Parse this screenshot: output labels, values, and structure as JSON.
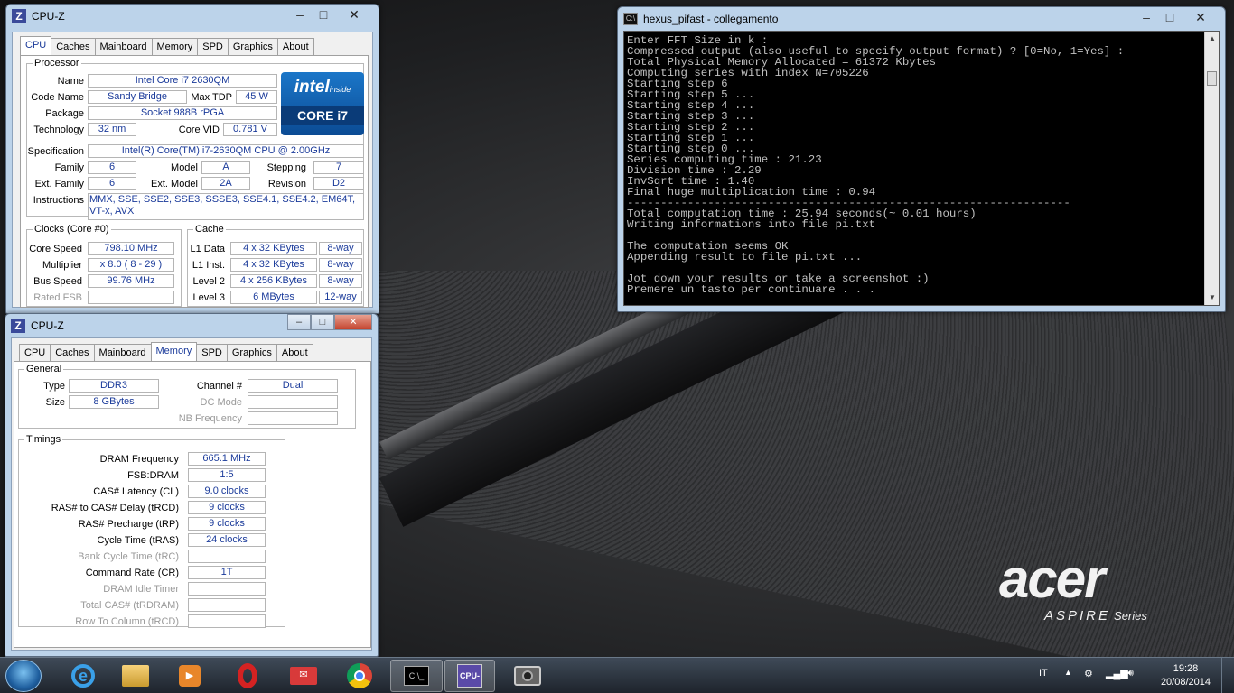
{
  "desktop": {
    "brand": "acer",
    "series_word": "ASPIRE",
    "series_suffix": "Series"
  },
  "cpuz_cpu": {
    "title": "CPU-Z",
    "tabs": [
      "CPU",
      "Caches",
      "Mainboard",
      "Memory",
      "SPD",
      "Graphics",
      "About"
    ],
    "processor": {
      "legend": "Processor",
      "name_label": "Name",
      "name": "Intel Core i7 2630QM",
      "codename_label": "Code Name",
      "codename": "Sandy Bridge",
      "maxtdp_label": "Max TDP",
      "maxtdp": "45 W",
      "package_label": "Package",
      "package": "Socket 988B rPGA",
      "tech_label": "Technology",
      "tech": "32 nm",
      "corevid_label": "Core VID",
      "corevid": "0.781 V",
      "spec_label": "Specification",
      "spec": "Intel(R) Core(TM) i7-2630QM CPU @ 2.00GHz",
      "family_label": "Family",
      "family": "6",
      "model_label": "Model",
      "model": "A",
      "stepping_label": "Stepping",
      "stepping": "7",
      "extfamily_label": "Ext. Family",
      "extfamily": "6",
      "extmodel_label": "Ext. Model",
      "extmodel": "2A",
      "revision_label": "Revision",
      "revision": "D2",
      "instr_label": "Instructions",
      "instr": "MMX, SSE, SSE2, SSE3, SSSE3, SSE4.1, SSE4.2, EM64T, VT-x, AVX"
    },
    "logo": {
      "intel": "intel",
      "inside": "inside",
      "core": "CORE i7"
    },
    "clocks": {
      "legend": "Clocks (Core #0)",
      "corespeed_label": "Core Speed",
      "corespeed": "798.10 MHz",
      "mult_label": "Multiplier",
      "mult": "x 8.0 ( 8 - 29 )",
      "bus_label": "Bus Speed",
      "bus": "99.76 MHz",
      "fsb_label": "Rated FSB",
      "fsb": ""
    },
    "cache": {
      "legend": "Cache",
      "l1d_label": "L1 Data",
      "l1d": "4 x 32 KBytes",
      "l1d_way": "8-way",
      "l1i_label": "L1 Inst.",
      "l1i": "4 x 32 KBytes",
      "l1i_way": "8-way",
      "l2_label": "Level 2",
      "l2": "4 x 256 KBytes",
      "l2_way": "8-way",
      "l3_label": "Level 3",
      "l3": "6 MBytes",
      "l3_way": "12-way"
    }
  },
  "cpuz_mem": {
    "title": "CPU-Z",
    "tabs": [
      "CPU",
      "Caches",
      "Mainboard",
      "Memory",
      "SPD",
      "Graphics",
      "About"
    ],
    "general": {
      "legend": "General",
      "type_label": "Type",
      "type": "DDR3",
      "size_label": "Size",
      "size": "8 GBytes",
      "channel_label": "Channel #",
      "channel": "Dual",
      "dcmode_label": "DC Mode",
      "dcmode": "",
      "nbfreq_label": "NB Frequency",
      "nbfreq": ""
    },
    "timings": {
      "legend": "Timings",
      "rows": [
        {
          "label": "DRAM Frequency",
          "value": "665.1 MHz",
          "enabled": true
        },
        {
          "label": "FSB:DRAM",
          "value": "1:5",
          "enabled": true
        },
        {
          "label": "CAS# Latency (CL)",
          "value": "9.0 clocks",
          "enabled": true
        },
        {
          "label": "RAS# to CAS# Delay (tRCD)",
          "value": "9 clocks",
          "enabled": true
        },
        {
          "label": "RAS# Precharge (tRP)",
          "value": "9 clocks",
          "enabled": true
        },
        {
          "label": "Cycle Time (tRAS)",
          "value": "24 clocks",
          "enabled": true
        },
        {
          "label": "Bank Cycle Time (tRC)",
          "value": "",
          "enabled": false
        },
        {
          "label": "Command Rate (CR)",
          "value": "1T",
          "enabled": true
        },
        {
          "label": "DRAM Idle Timer",
          "value": "",
          "enabled": false
        },
        {
          "label": "Total CAS# (tRDRAM)",
          "value": "",
          "enabled": false
        },
        {
          "label": "Row To Column (tRCD)",
          "value": "",
          "enabled": false
        }
      ]
    }
  },
  "console": {
    "title": "hexus_pifast - collegamento",
    "lines": [
      "Enter FFT Size in k :",
      "Compressed output (also useful to specify output format) ? [0=No, 1=Yes] :",
      "Total Physical Memory Allocated = 61372 Kbytes",
      "Computing series with index N=705226",
      "Starting step 6",
      "Starting step 5 ...",
      "Starting step 4 ...",
      "Starting step 3 ...",
      "Starting step 2 ...",
      "Starting step 1 ...",
      "Starting step 0 ...",
      "Series computing time : 21.23",
      "Division time : 2.29",
      "InvSqrt time : 1.40",
      "Final huge multiplication time : 0.94",
      "------------------------------------------------------------------",
      "Total computation time : 25.94 seconds(~ 0.01 hours)",
      "Writing informations into file pi.txt",
      "",
      "The computation seems OK",
      "Appending result to file pi.txt ...",
      "",
      "Jot down your results or take a screenshot :)",
      "Premere un tasto per continuare . . ."
    ]
  },
  "taskbar": {
    "lang": "IT",
    "time": "19:28",
    "date": "20/08/2014",
    "pinned": [
      "internet-explorer-icon",
      "explorer-icon",
      "media-player-icon",
      "opera-icon",
      "mail-icon",
      "chrome-icon",
      "cmd-icon",
      "cpuz-icon",
      "camera-icon"
    ]
  }
}
